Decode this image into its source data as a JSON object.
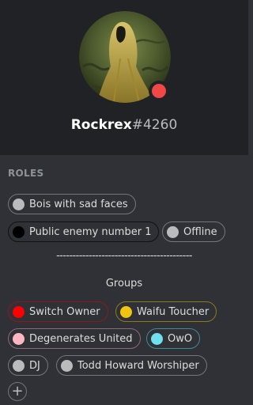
{
  "profile": {
    "username": "Rockrex",
    "discriminator": "#4260",
    "status_color": "#f04747"
  },
  "roles_section": {
    "title": "ROLES"
  },
  "roles": [
    {
      "label": "Bois with sad faces",
      "dot_color": "#b9bbbe",
      "border_color": "#72767d"
    },
    {
      "label": "Public enemy number 1",
      "dot_color": "#000000",
      "border_color": "#101113"
    },
    {
      "label": "Offline",
      "dot_color": "#b9bbbe",
      "border_color": "#72767d"
    }
  ],
  "divider_text": "------------------------------------------",
  "groups": {
    "label": "Groups",
    "roles": [
      {
        "label": "Switch Owner",
        "dot_color": "#ff0000",
        "border_color": "#8b1a1a"
      },
      {
        "label": "Waifu Toucher",
        "dot_color": "#f1c40f",
        "border_color": "#8a7a1a"
      },
      {
        "label": "Degenerates United",
        "dot_color": "#ffb6c1",
        "border_color": "#8a6a72"
      },
      {
        "label": "OwO",
        "dot_color": "#6ee0f0",
        "border_color": "#3f8a94"
      },
      {
        "label": "DJ",
        "dot_color": "#b9bbbe",
        "border_color": "#72767d"
      },
      {
        "label": "Todd Howard Worshiper",
        "dot_color": "#b9bbbe",
        "border_color": "#72767d"
      }
    ]
  },
  "add_role": {
    "symbol": "+"
  }
}
